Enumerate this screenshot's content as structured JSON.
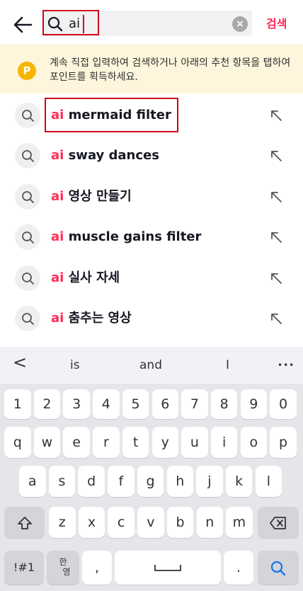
{
  "search": {
    "query": "ai",
    "clear_symbol": "×",
    "submit_label": "검색"
  },
  "banner": {
    "coin_letter": "P",
    "text": "계속 직접 입력하여 검색하거나 아래의 추천 항목을 탭하여 포인트를 획득하세요."
  },
  "suggestions": [
    {
      "prefix": "ai",
      "rest": " mermaid filter"
    },
    {
      "prefix": "ai",
      "rest": " sway dances"
    },
    {
      "prefix": "ai",
      "rest": " 영상 만들기"
    },
    {
      "prefix": "ai",
      "rest": " muscle gains filter"
    },
    {
      "prefix": "ai",
      "rest": " 실사 자세"
    },
    {
      "prefix": "ai",
      "rest": " 춤추는 영상"
    }
  ],
  "keyboard": {
    "back_symbol": "<",
    "predictions": [
      "is",
      "and",
      "I"
    ],
    "more_symbol": "•••",
    "row_numbers": [
      "1",
      "2",
      "3",
      "4",
      "5",
      "6",
      "7",
      "8",
      "9",
      "0"
    ],
    "row1": [
      "q",
      "w",
      "e",
      "r",
      "t",
      "y",
      "u",
      "i",
      "o",
      "p"
    ],
    "row2": [
      "a",
      "s",
      "d",
      "f",
      "g",
      "h",
      "j",
      "k",
      "l"
    ],
    "row3": [
      "z",
      "x",
      "c",
      "v",
      "b",
      "n",
      "m"
    ],
    "symbols_key": "!#1",
    "lang_key_top": "한",
    "lang_key_bottom": "영",
    "comma": ",",
    "period": "."
  },
  "colors": {
    "accent": "#fe2c55",
    "highlight_box": "#d0021b",
    "coin": "#f7b500",
    "banner_bg": "#fdf6dd"
  }
}
